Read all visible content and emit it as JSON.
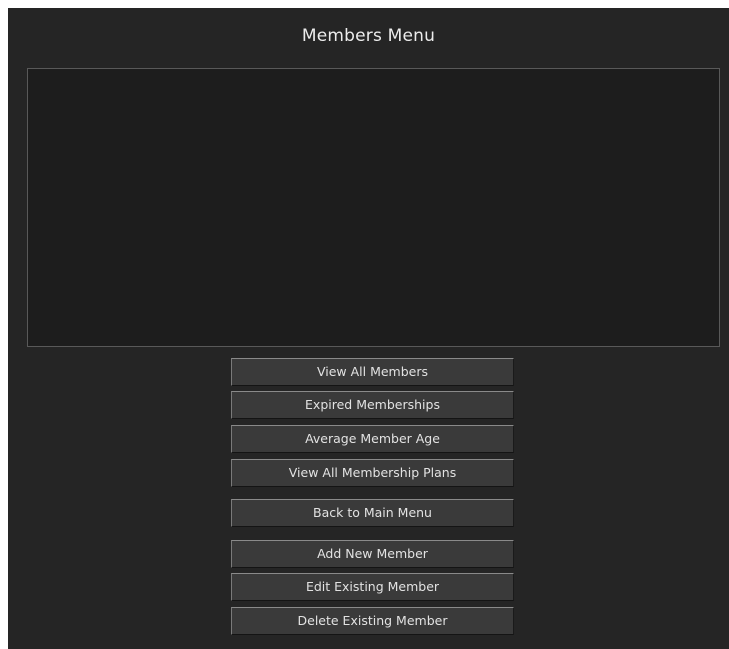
{
  "window": {
    "title": "Members Menu"
  },
  "buttons": {
    "view_all_members": "View All Members",
    "expired_memberships": "Expired Memberships",
    "average_member_age": "Average Member Age",
    "view_all_membership_plans": "View All Membership Plans",
    "back_to_main_menu": "Back to Main Menu",
    "add_new_member": "Add New Member",
    "edit_existing_member": "Edit Existing Member",
    "delete_existing_member": "Delete Existing Member"
  },
  "colors": {
    "window_background": "#252525",
    "output_background": "#1d1d1d",
    "button_background": "#3a3a3a",
    "text": "#e2e2e2"
  }
}
